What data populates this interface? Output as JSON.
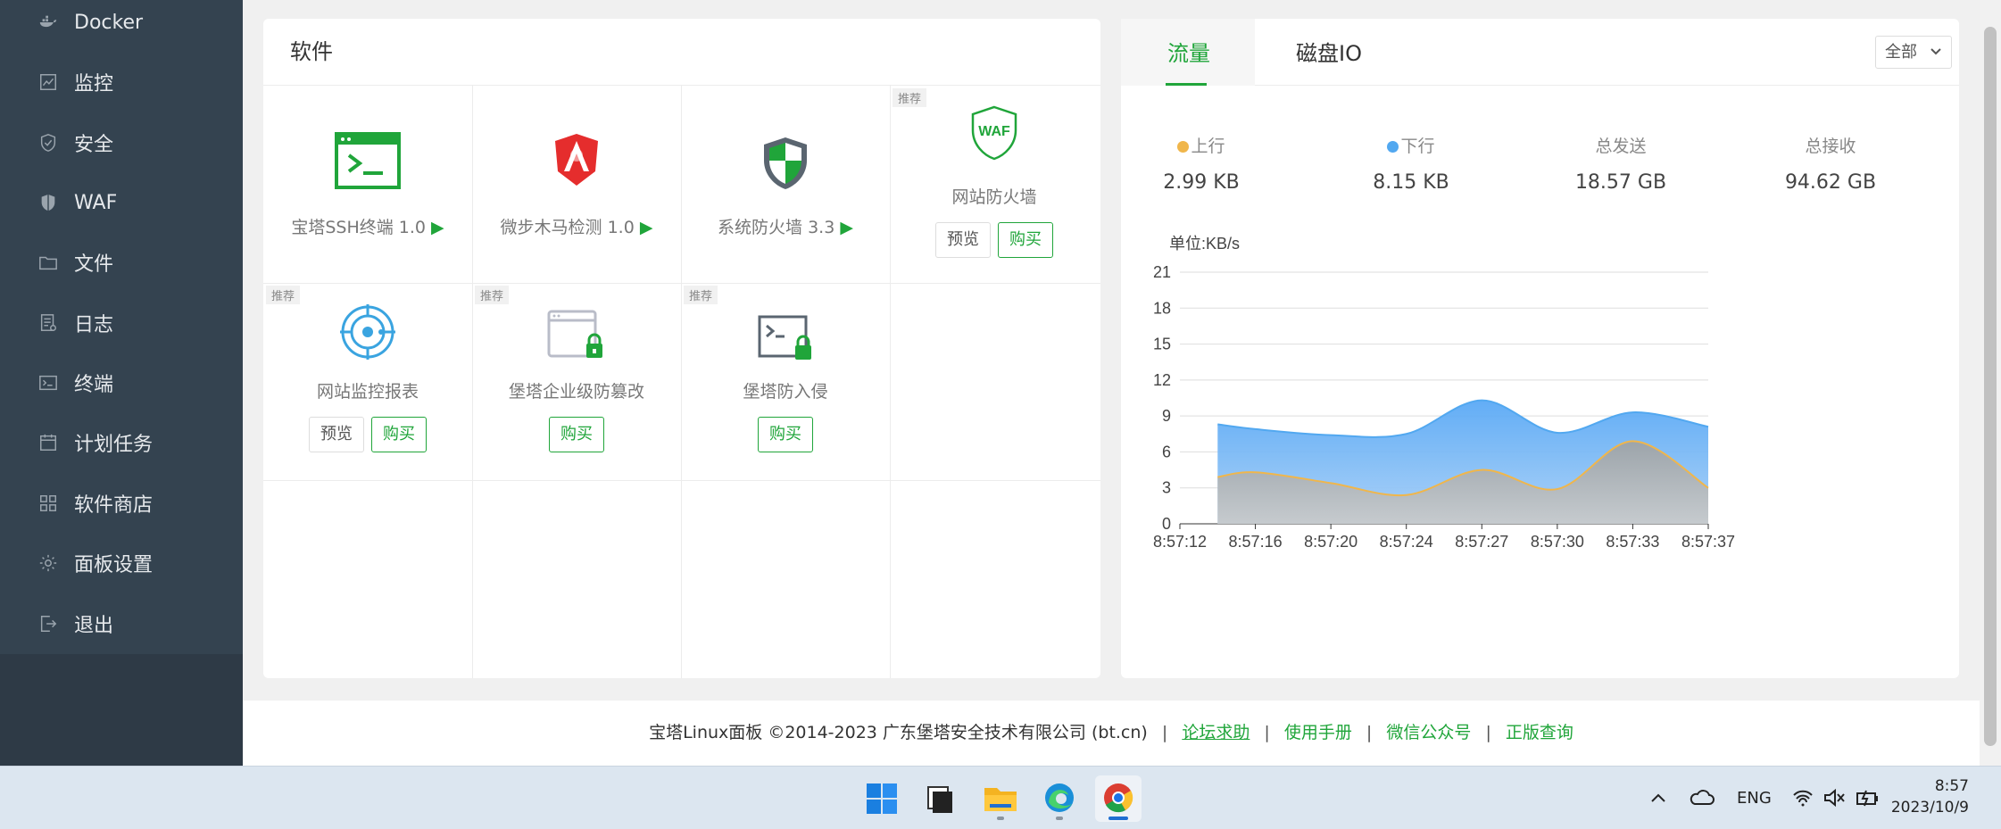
{
  "sidebar": {
    "items": [
      {
        "label": "Docker",
        "icon": "docker-icon"
      },
      {
        "label": "监控",
        "icon": "monitor-icon"
      },
      {
        "label": "安全",
        "icon": "shield-icon"
      },
      {
        "label": "WAF",
        "icon": "waf-shield-icon"
      },
      {
        "label": "文件",
        "icon": "folder-icon"
      },
      {
        "label": "日志",
        "icon": "log-icon"
      },
      {
        "label": "终端",
        "icon": "terminal-icon"
      },
      {
        "label": "计划任务",
        "icon": "calendar-icon"
      },
      {
        "label": "软件商店",
        "icon": "apps-grid-icon"
      },
      {
        "label": "面板设置",
        "icon": "gear-icon"
      },
      {
        "label": "退出",
        "icon": "logout-icon"
      }
    ]
  },
  "software": {
    "title": "软件",
    "tag": "推荐",
    "play_glyph": "▶",
    "preview_label": "预览",
    "buy_label": "购买",
    "items": [
      {
        "name": "宝塔SSH终端 1.0",
        "recommended": false
      },
      {
        "name": "微步木马检测 1.0",
        "recommended": false
      },
      {
        "name": "系统防火墙 3.3",
        "recommended": false
      },
      {
        "name": "网站防火墙",
        "recommended": true,
        "icon_text": "WAF"
      },
      {
        "name": "网站监控报表",
        "recommended": true
      },
      {
        "name": "堡塔企业级防篡改",
        "recommended": true
      },
      {
        "name": "堡塔防入侵",
        "recommended": true
      }
    ]
  },
  "traffic": {
    "tabs": [
      "流量",
      "磁盘IO"
    ],
    "select_value": "全部",
    "stats": [
      {
        "label": "上行",
        "value": "2.99 KB",
        "color": "#f0b64b"
      },
      {
        "label": "下行",
        "value": "8.15 KB",
        "color": "#52a8f0"
      },
      {
        "label": "总发送",
        "value": "18.57 GB"
      },
      {
        "label": "总接收",
        "value": "94.62 GB"
      }
    ]
  },
  "chart_data": {
    "type": "area",
    "ylabel": "单位:KB/s",
    "ylim": [
      0,
      21
    ],
    "yticks": [
      0,
      3,
      6,
      9,
      12,
      15,
      18,
      21
    ],
    "x_ticks": [
      "8:57:12",
      "8:57:16",
      "8:57:20",
      "8:57:24",
      "8:57:27",
      "8:57:30",
      "8:57:33",
      "8:57:37"
    ],
    "x": [
      0.5,
      1,
      2,
      3,
      4,
      5,
      6,
      7
    ],
    "series": [
      {
        "name": "下行",
        "color": "#52a8f0",
        "values": [
          8.3,
          7.9,
          7.4,
          7.5,
          10.3,
          7.6,
          9.3,
          8.1
        ]
      },
      {
        "name": "上行",
        "color": "#f0b64b",
        "values": [
          3.9,
          4.3,
          3.4,
          2.4,
          4.5,
          2.9,
          6.9,
          3.0
        ]
      }
    ]
  },
  "footer": {
    "copyright": "宝塔Linux面板 ©2014-2023 广东堡塔安全技术有限公司 (bt.cn)",
    "links": [
      "论坛求助",
      "使用手册",
      "微信公众号",
      "正版查询"
    ],
    "sep": "|"
  },
  "taskbar": {
    "lang": "ENG",
    "time": "8:57",
    "date": "2023/10/9"
  }
}
